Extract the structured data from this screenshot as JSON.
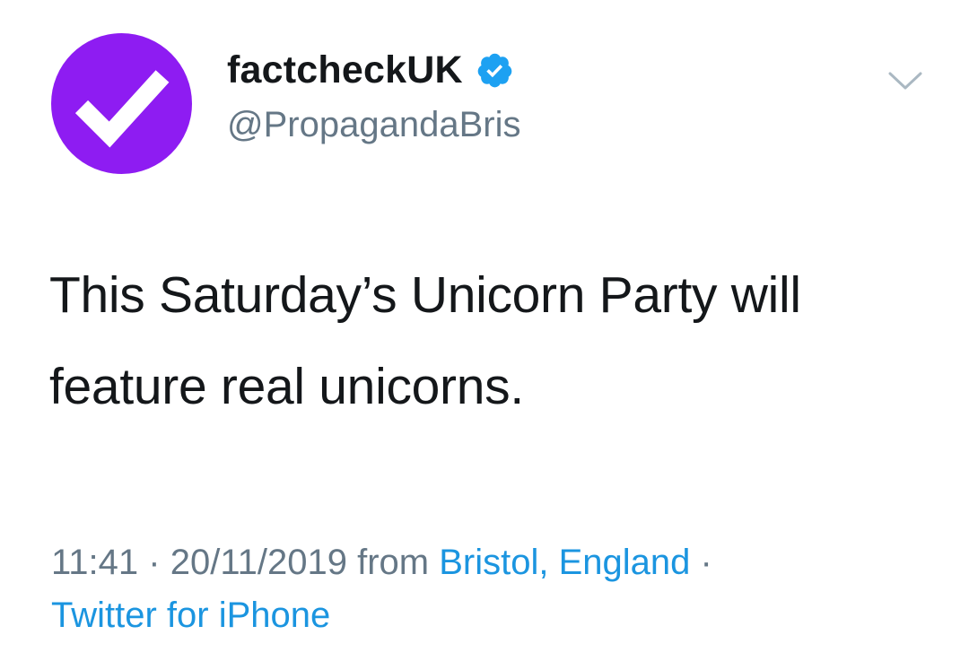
{
  "account": {
    "display_name": "factcheckUK",
    "handle": "@PropagandaBris",
    "verified": true,
    "avatar_color": "#8e1cf2",
    "avatar_icon": "checkmark-icon"
  },
  "tweet": {
    "text_line1": "This Saturday’s Unicorn Party will",
    "text_line2": "feature real unicorns.",
    "time": "11:41",
    "date": "20/11/2019",
    "from_label": "from",
    "location": "Bristol, England",
    "separator": "·",
    "source": "Twitter for iPhone"
  },
  "colors": {
    "link": "#1b95e0",
    "secondary_text": "#657786",
    "primary_text": "#14171a",
    "verified_badge": "#1da1f2"
  }
}
